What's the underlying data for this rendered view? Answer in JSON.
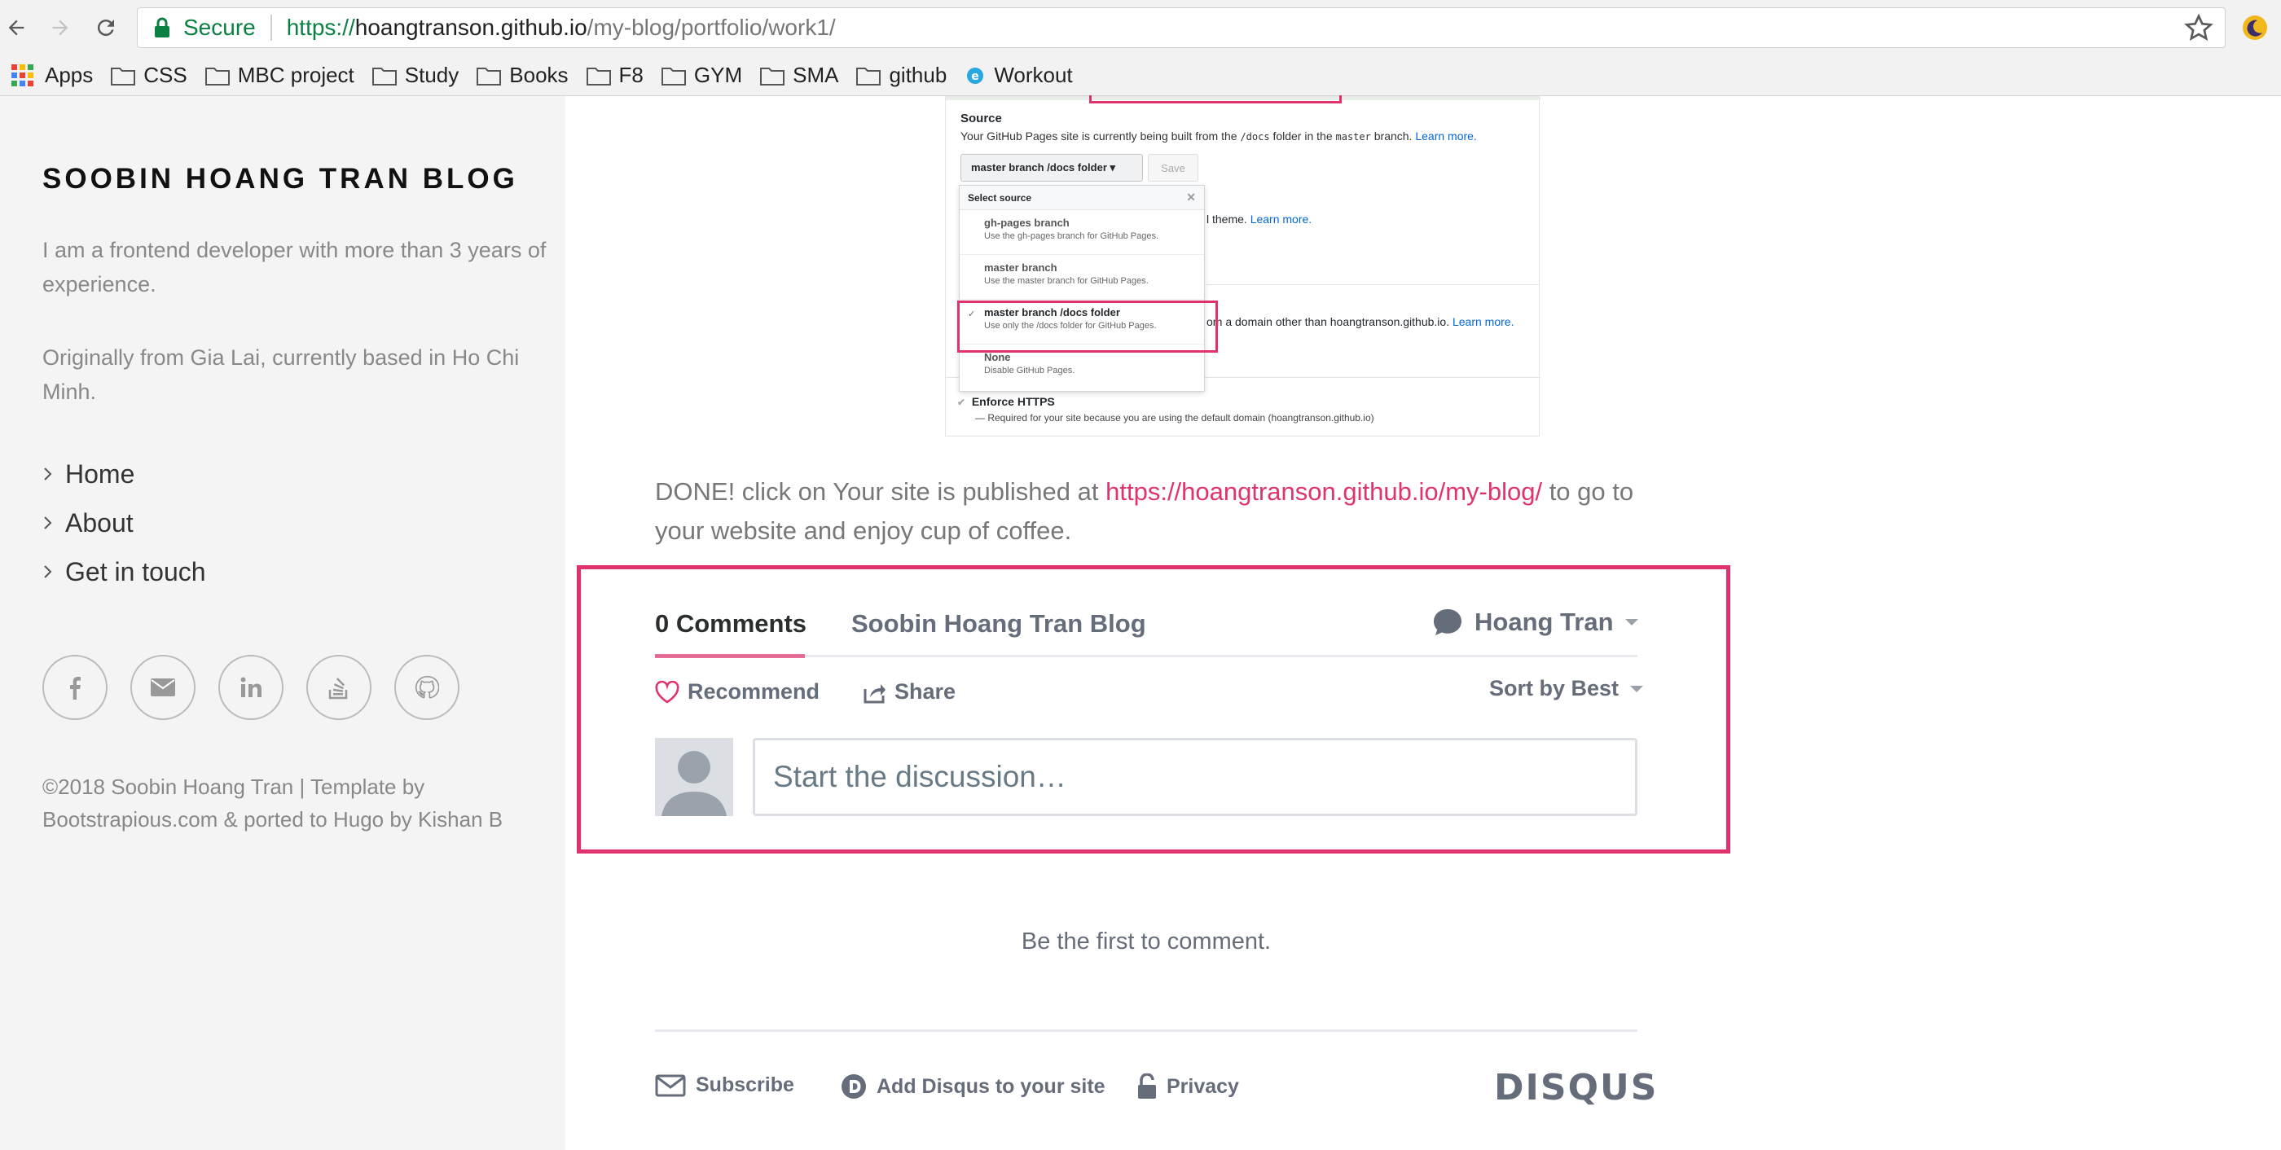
{
  "browser": {
    "secure_label": "Secure",
    "url_scheme": "https://",
    "url_host": "hoangtranson.github.io",
    "url_path": "/my-blog/portfolio/work1/",
    "bookmarks": [
      "Apps",
      "CSS",
      "MBC project",
      "Study",
      "Books",
      "F8",
      "GYM",
      "SMA",
      "github",
      "Workout"
    ]
  },
  "sidebar": {
    "title": "SOOBIN HOANG TRAN BLOG",
    "intro": "I am a frontend developer with more than 3 years of experience.",
    "origin": "Originally from Gia Lai, currently based in Ho Chi Minh.",
    "nav": [
      "Home",
      "About",
      "Get in touch"
    ],
    "socials": [
      "facebook-icon",
      "email-icon",
      "linkedin-icon",
      "stackoverflow-icon",
      "github-icon"
    ],
    "copyright": "©2018 Soobin Hoang Tran | Template by Bootstrapious.com & ported to Hugo by Kishan B"
  },
  "screenshot": {
    "source_heading": "Source",
    "source_desc_a": "Your GitHub Pages site is currently being built from the ",
    "source_desc_code1": "/docs",
    "source_desc_b": " folder in the ",
    "source_desc_code2": "master",
    "source_desc_c": " branch. ",
    "learn_more": "Learn more.",
    "branch_button": "master branch /docs folder ▾",
    "save_button": "Save",
    "menu_header": "Select source",
    "options": [
      {
        "title": "gh-pages branch",
        "desc": "Use the gh-pages branch for GitHub Pages."
      },
      {
        "title": "master branch",
        "desc": "Use the master branch for GitHub Pages."
      },
      {
        "title": "master branch /docs folder",
        "desc": "Use only the /docs folder for GitHub Pages."
      },
      {
        "title": "None",
        "desc": "Disable GitHub Pages."
      }
    ],
    "theme_text": "l theme. ",
    "domain_text": "om a domain other than hoangtranson.github.io. ",
    "https_heading": "Enforce HTTPS",
    "https_desc": "— Required for your site because you are using the default domain (hoangtranson.github.io)"
  },
  "main": {
    "done_a": "DONE! click on Your site is published at ",
    "done_link": "https://hoangtranson.github.io/my-blog/",
    "done_b": " to go to your website and enjoy cup of coffee."
  },
  "disqus": {
    "comments_tab": "0 Comments",
    "blog_tab": "Soobin Hoang Tran Blog",
    "user": "Hoang Tran",
    "recommend": "Recommend",
    "share": "Share",
    "sort": "Sort by Best",
    "placeholder": "Start the discussion…",
    "first": "Be the first to comment.",
    "subscribe": "Subscribe",
    "add_disqus": "Add Disqus to your site",
    "privacy": "Privacy",
    "logo": "DISQUS",
    "accent": "#e0336e"
  }
}
